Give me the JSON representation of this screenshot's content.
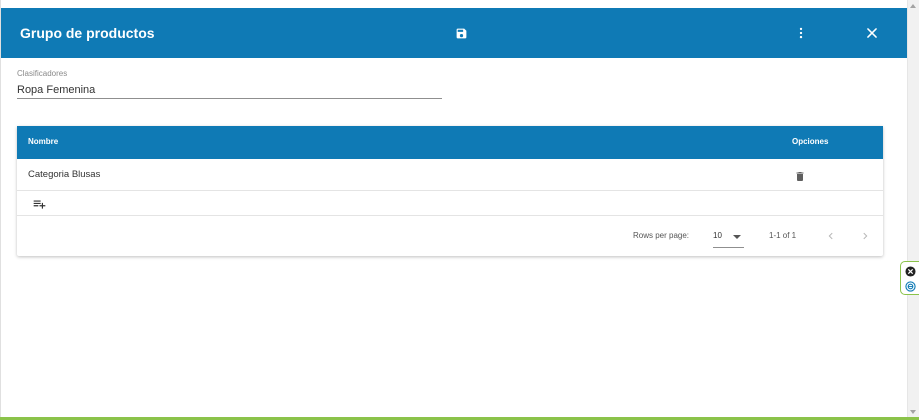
{
  "dialog": {
    "title": "Grupo de productos"
  },
  "field": {
    "label": "Clasificadores",
    "value": "Ropa Femenina"
  },
  "table": {
    "columns": [
      "Nombre",
      "Opciones"
    ],
    "rows": [
      {
        "nombre": "Categoria Blusas"
      }
    ]
  },
  "pagination": {
    "rows_per_page_label": "Rows per page:",
    "rows_per_page_value": "10",
    "range": "1-1 of 1"
  },
  "colors": {
    "primary": "#0f7ab5",
    "accent": "#8bc34a"
  },
  "icons": {
    "save": "save-icon",
    "more": "more-vert-icon",
    "close": "close-icon",
    "delete": "trash-icon",
    "add_row": "playlist-add-icon",
    "prev": "chevron-left-icon",
    "next": "chevron-right-icon"
  }
}
